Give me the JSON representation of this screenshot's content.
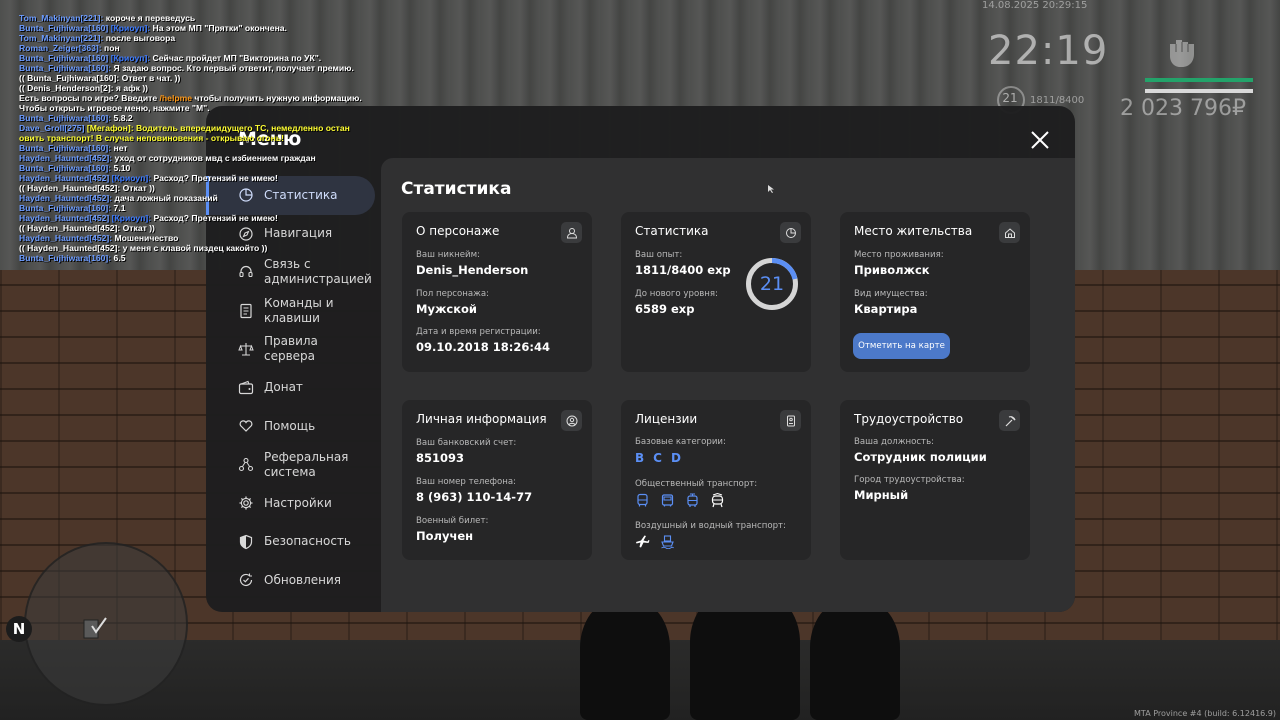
{
  "hud": {
    "datetime": "14.08.2025 20:29:15",
    "time": "22:19",
    "level": "21",
    "exp": "1811/8400",
    "money": "2 023 796₽",
    "health_color": "#23a36a",
    "armor_color": "#d9d9d9"
  },
  "chat": [
    {
      "name": "Tom_Makinyan[221]:",
      "text": " короче я переведусь"
    },
    {
      "name": "Bunta_Fujhiwara[160]",
      "accent": " [Криоуп]:",
      "text": " На этом МП \"Прятки\" окончена."
    },
    {
      "name": "Tom_Makinyan[221]:",
      "text": " после выговора"
    },
    {
      "name": "Roman_Zeiger[363]:",
      "text": " пон"
    },
    {
      "name": "Bunta_Fujhiwara[160]",
      "accent": " [Криоуп]:",
      "text": " Сейчас пройдет МП \"Викторина по УК\"."
    },
    {
      "name": "Bunta_Fujhiwara[160]:",
      "text": " Я задаю вопрос. Кто первый ответит, получает премию."
    },
    {
      "text": "(( Bunta_Fujhiwara[160]: Ответ в чат. ))"
    },
    {
      "text": "(( Denis_Henderson[2]: я афк ))"
    },
    {
      "text": "Есть вопросы по игре? Введите ",
      "orange": "/helpme",
      "text2": " чтобы получить нужную информацию."
    },
    {
      "text": "Чтобы открыть игровое меню, нажмите \"М\"."
    },
    {
      "name": "Bunta_Fujhiwara[160]:",
      "text": " 5.8.2"
    },
    {
      "name": "Dave_Groll[275]",
      "yellow": " [Мегафон]: Водитель впередиидущего ТС, немедленно остан"
    },
    {
      "yellow": "овить транспорт! В случае неповиновения - открываю огонь!"
    },
    {
      "name": "Bunta_Fujhiwara[160]:",
      "text": " нет"
    },
    {
      "name": "Hayden_Haunted[452]:",
      "text": " уход от сотрудников мвд с избиением граждан"
    },
    {
      "name": "Bunta_Fujhiwara[160]:",
      "text": " 5.10"
    },
    {
      "name": "Hayden_Haunted[452]",
      "accent": " [Криоуп]:",
      "text": " Расход? Претензий не имею!"
    },
    {
      "text": "(( Hayden_Haunted[452]: Откат ))"
    },
    {
      "name": "Hayden_Haunted[452]:",
      "text": " дача ложный показаний"
    },
    {
      "name": "Bunta_Fujhiwara[160]:",
      "text": " 7.1"
    },
    {
      "name": "Hayden_Haunted[452]",
      "accent": " [Криоуп]:",
      "text": " Расход? Претензий не имею!"
    },
    {
      "text": "(( Hayden_Haunted[452]: Откат ))"
    },
    {
      "name": "Hayden_Haunted[452]:",
      "text": " Мошеничество"
    },
    {
      "text": "(( Hayden_Haunted[452]: у меня с клавой пиздец какойто ))"
    },
    {
      "name": "Bunta_Fujhiwara[160]:",
      "text": " 6.5"
    }
  ],
  "menu": {
    "title": "Меню",
    "nav": [
      {
        "label": "Статистика",
        "icon": "pie-chart-icon",
        "active": true
      },
      {
        "label": "Навигация",
        "icon": "compass-icon"
      },
      {
        "label": "Связь с администрацией",
        "icon": "headset-icon"
      },
      {
        "label": "Команды и клавиши",
        "icon": "document-icon"
      },
      {
        "label": "Правила сервера",
        "icon": "scales-icon"
      },
      {
        "label": "Донат",
        "icon": "wallet-icon"
      },
      {
        "label": "Помощь",
        "icon": "heart-hand-icon"
      },
      {
        "label": "Реферальная система",
        "icon": "people-icon"
      },
      {
        "label": "Настройки",
        "icon": "gear-icon"
      },
      {
        "label": "Безопасность",
        "icon": "shield-icon"
      },
      {
        "label": "Обновления",
        "icon": "refresh-check-icon"
      }
    ]
  },
  "content": {
    "title": "Статистика",
    "cards": {
      "character": {
        "title": "О персонаже",
        "icon": "user-icon",
        "fields": [
          {
            "label": "Ваш никнейм:",
            "value": "Denis_Henderson"
          },
          {
            "label": "Пол персонажа:",
            "value": "Мужской"
          },
          {
            "label": "Дата и время регистрации:",
            "value": "09.10.2018 18:26:44"
          }
        ]
      },
      "stats": {
        "title": "Статистика",
        "icon": "pie-chart-icon",
        "fields": [
          {
            "label": "Ваш опыт:",
            "value": "1811/8400 exp"
          },
          {
            "label": "До нового уровня:",
            "value": "6589 exp"
          }
        ],
        "level": "21",
        "progress": 0.2156,
        "accent": "#5b8ff5"
      },
      "residence": {
        "title": "Место жительства",
        "icon": "house-icon",
        "fields": [
          {
            "label": "Место проживания:",
            "value": "Приволжск"
          },
          {
            "label": "Вид имущества:",
            "value": "Квартира"
          }
        ],
        "button": "Отметить на карте"
      },
      "personal": {
        "title": "Личная информация",
        "icon": "user-circle-icon",
        "fields": [
          {
            "label": "Ваш банковский счет:",
            "value": "851093"
          },
          {
            "label": "Ваш номер телефона:",
            "value": "8 (963) 110-14-77"
          },
          {
            "label": "Военный билет:",
            "value": "Получен"
          }
        ]
      },
      "licenses": {
        "title": "Лицензии",
        "icon": "id-card-icon",
        "base_label": "Базовые категории:",
        "categories": [
          "B",
          "C",
          "D"
        ],
        "public_label": "Общественный транспорт:",
        "public_icons": [
          "bus-icon",
          "bus-icon",
          "tram-icon",
          "trolleybus-icon"
        ],
        "air_label": "Воздушный и водный транспорт:",
        "air_icons": [
          "airplane-icon",
          "ship-icon"
        ]
      },
      "employment": {
        "title": "Трудоустройство",
        "icon": "pickaxe-icon",
        "fields": [
          {
            "label": "Ваша должность:",
            "value": "Сотрудник полиции"
          },
          {
            "label": "Город трудоустройства:",
            "value": "Мирный"
          }
        ]
      }
    }
  },
  "minimap": {
    "north": "N"
  },
  "build": "MTA Province #4 (build: 6.12416.9)"
}
